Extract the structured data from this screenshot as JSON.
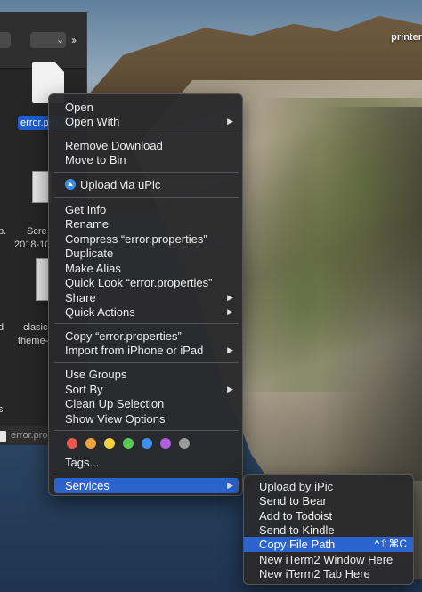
{
  "desktop": {
    "label": "printer"
  },
  "finder": {
    "selected_file": "error.pro",
    "side_texts": [
      "p.",
      "Scre",
      "2018-10",
      "d",
      "clasic",
      "theme-",
      "s"
    ],
    "pathbar": "error.pro"
  },
  "context_menu": {
    "open": "Open",
    "open_with": "Open With",
    "remove_download": "Remove Download",
    "move_to_bin": "Move to Bin",
    "upload_upic": "Upload via uPic",
    "get_info": "Get Info",
    "rename": "Rename",
    "compress": "Compress “error.properties”",
    "duplicate": "Duplicate",
    "make_alias": "Make Alias",
    "quick_look": "Quick Look “error.properties”",
    "share": "Share",
    "quick_actions": "Quick Actions",
    "copy": "Copy “error.properties”",
    "import_iphone": "Import from iPhone or iPad",
    "use_groups": "Use Groups",
    "sort_by": "Sort By",
    "clean_up": "Clean Up Selection",
    "view_options": "Show View Options",
    "tags": "Tags...",
    "services": "Services",
    "tag_colors": [
      "#e85a4f",
      "#f0a23b",
      "#f2d23c",
      "#5cc85a",
      "#3d8ff0",
      "#b35fe0",
      "#9b9b9b"
    ]
  },
  "services_menu": {
    "items": [
      "Upload by iPic",
      "Send to Bear",
      "Add to Todoist",
      "Send to Kindle",
      "Copy File Path",
      "New iTerm2 Window Here",
      "New iTerm2 Tab Here"
    ],
    "copy_path_shortcut": "^⇧⌘C"
  }
}
